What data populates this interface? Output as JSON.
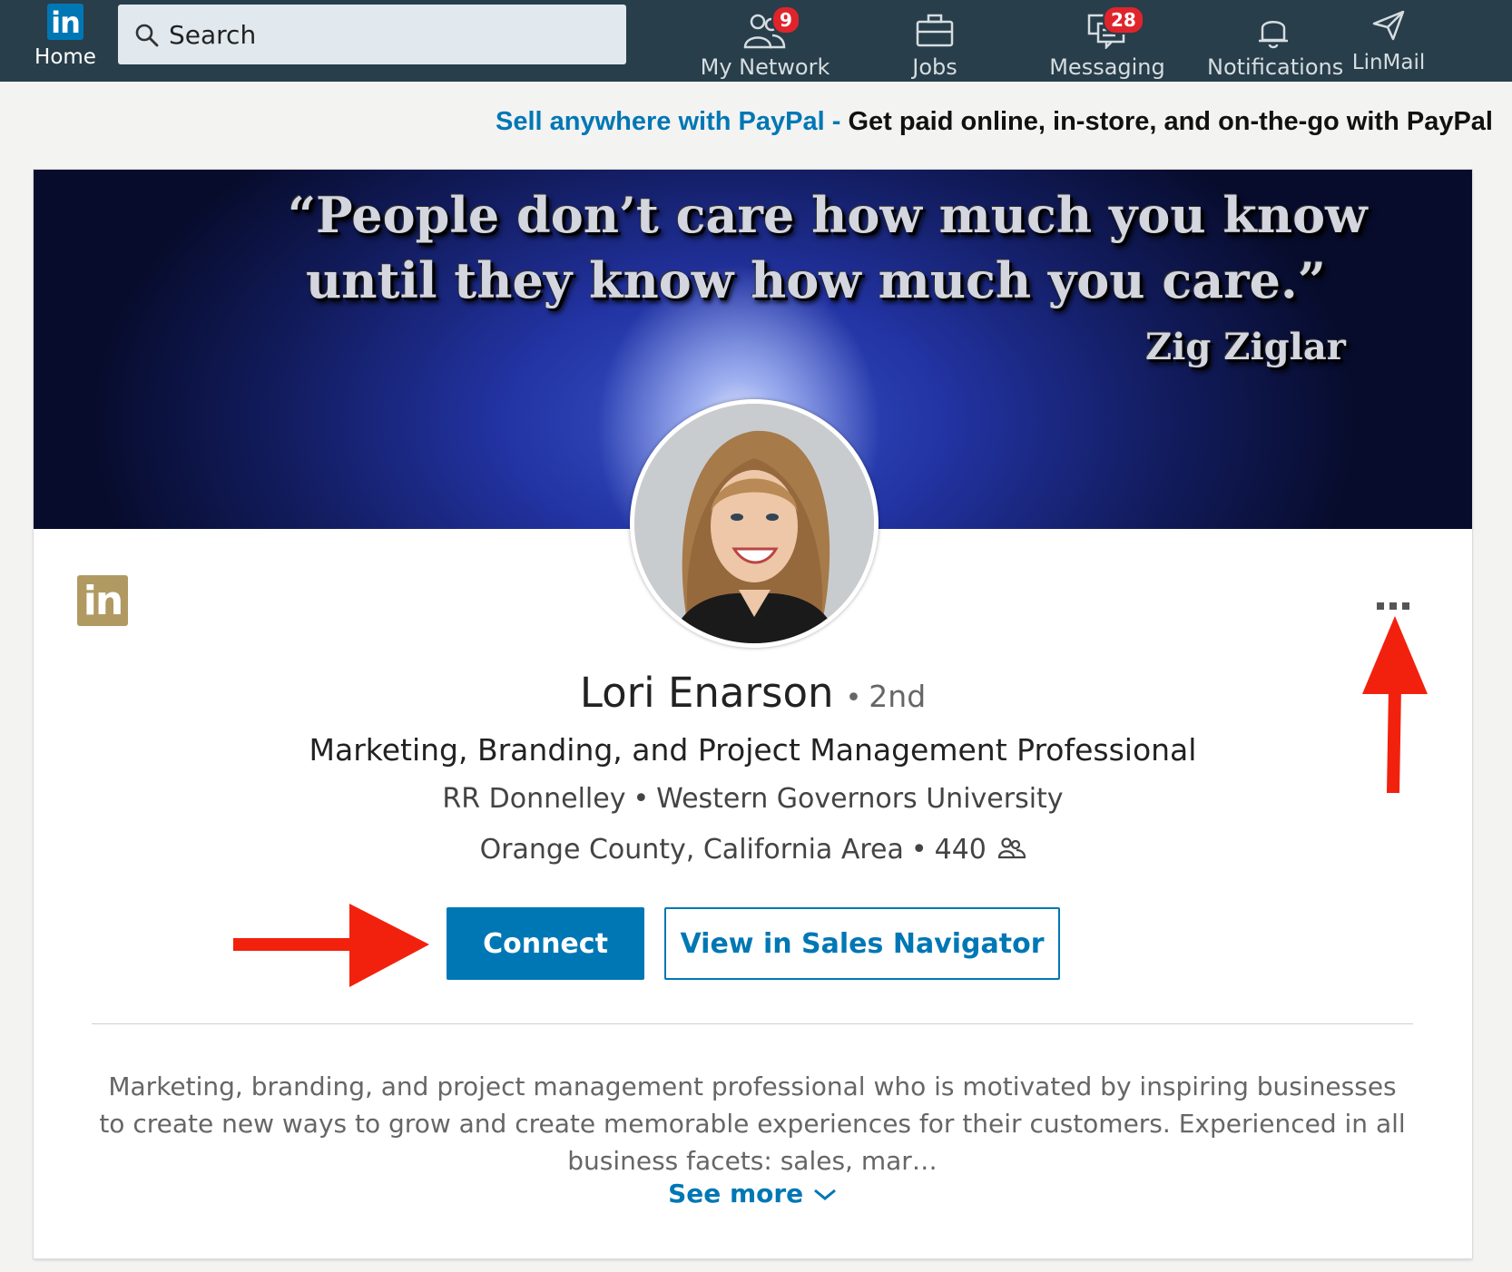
{
  "nav": {
    "home_label": "Home",
    "logo_text": "in",
    "search_placeholder": "Search",
    "items": [
      {
        "label": "My Network",
        "badge": "9"
      },
      {
        "label": "Jobs"
      },
      {
        "label": "Messaging",
        "badge": "28"
      },
      {
        "label": "Notifications"
      },
      {
        "label": "LinMail"
      }
    ]
  },
  "ad": {
    "link_text": "Sell anywhere with PayPal",
    "separator": " - ",
    "text": "Get paid online, in-store, and on-the-go with PayPal"
  },
  "banner": {
    "quote_line1": "“People don’t care how much you know",
    "quote_line2": "until they know how much you care.”",
    "quote_author": "Zig Ziglar"
  },
  "profile": {
    "name": "Lori Enarson",
    "degree": "2nd",
    "headline": "Marketing, Branding, and Project Management Professional",
    "company": "RR Donnelley",
    "school": "Western Governors University",
    "location": "Orange County, California Area",
    "connections": "440",
    "badge_logo_text": "in",
    "more_label": "..."
  },
  "actions": {
    "connect_label": "Connect",
    "sales_nav_label": "View in Sales Navigator"
  },
  "summary": {
    "text": "Marketing, branding, and project management professional who is motivated by inspiring businesses to create new ways to grow and create memorable experiences for their customers. Experienced in all business facets: sales, mar…",
    "see_more_label": "See more"
  },
  "colors": {
    "nav_bg": "#283e4a",
    "brand_blue": "#0077b5",
    "badge_red": "#e0242c",
    "annotation_red": "#f2210d"
  }
}
